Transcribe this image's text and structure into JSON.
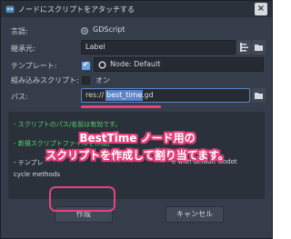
{
  "window": {
    "title": "ノードにスクリプトをアタッチする",
    "close_label": "×"
  },
  "form": {
    "language": {
      "label": "言語:",
      "value": "GDScript",
      "icon": "gdscript-icon"
    },
    "inherits": {
      "label": "継承元:",
      "value": "Label"
    },
    "template": {
      "label": "テンプレート:",
      "checked": true,
      "value": "Node: Default"
    },
    "builtin": {
      "label": "組み込みスクリプト:",
      "value": "オン",
      "checked": false
    },
    "path": {
      "label": "パス:",
      "prefix": "res://",
      "selected": "best_time",
      "suffix": ".gd"
    }
  },
  "status": {
    "lines": [
      "- スクリプトのパス/名前は有効です。",
      "- 新規スクリプトファイルを作成。",
      "- テンプレ",
      "e with default Godot",
      "cycle methods"
    ]
  },
  "annotation": {
    "line1": "BestTime ノード用の",
    "line2": "スクリプトを作成して割り当てます。"
  },
  "buttons": {
    "create": "作成",
    "cancel": "キャンセル"
  },
  "colors": {
    "accent": "#e8417c",
    "selection": "#5a86c7",
    "success": "#55d26a"
  }
}
